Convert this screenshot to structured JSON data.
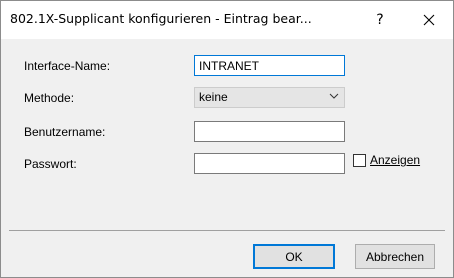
{
  "window": {
    "title": "802.1X-Supplicant konfigurieren - Eintrag bear...",
    "help_glyph": "?",
    "close_glyph": "✕"
  },
  "form": {
    "interface_label": "Interface-Name:",
    "interface_value": "INTRANET",
    "method_label": "Methode:",
    "method_value": "keine",
    "username_label": "Benutzername:",
    "username_value": "",
    "password_label": "Passwort:",
    "password_value": "",
    "show_label": "Anzeigen",
    "show_checked": false
  },
  "buttons": {
    "ok_label": "OK",
    "cancel_label": "Abbrechen"
  },
  "colors": {
    "focus": "#0078d7",
    "background": "#f0f0f0"
  }
}
